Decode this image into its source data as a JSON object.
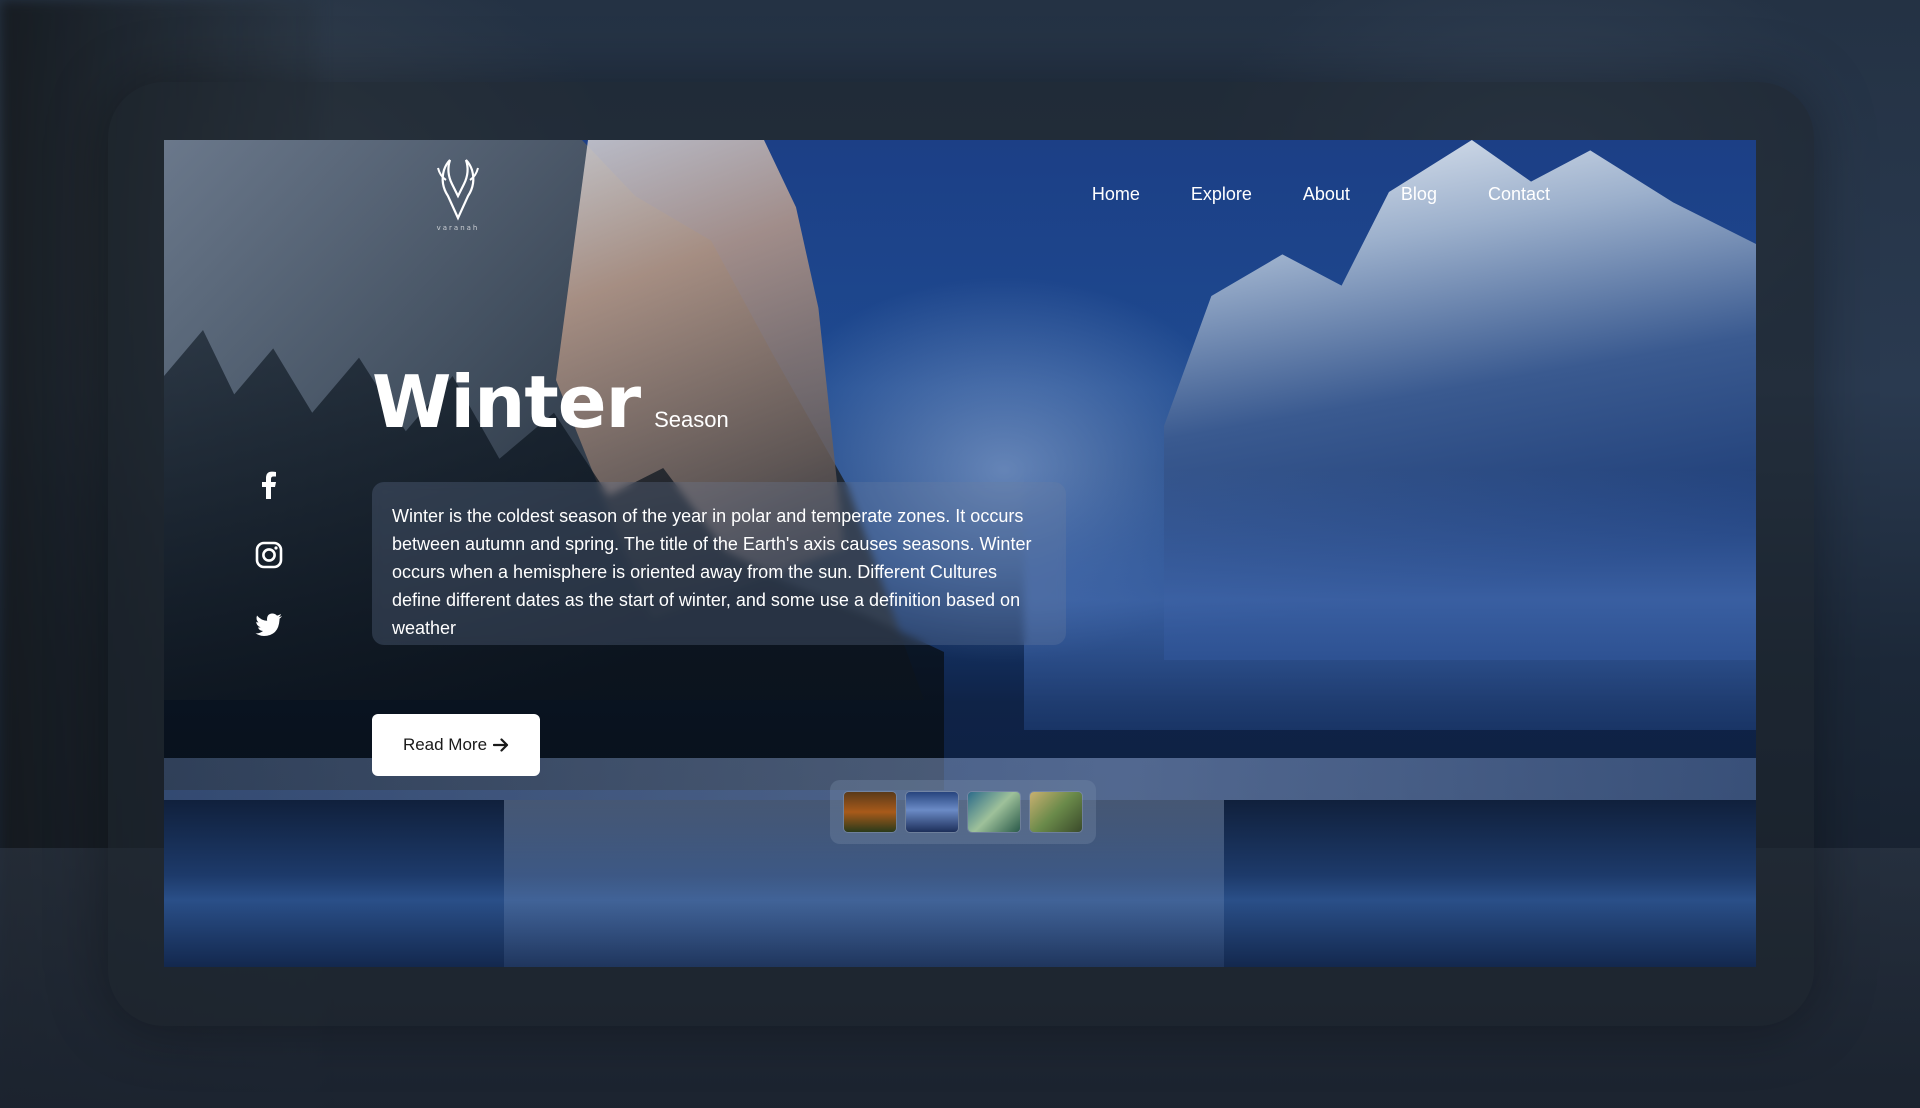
{
  "brand": {
    "name": "varanah"
  },
  "nav": {
    "items": [
      {
        "label": "Home"
      },
      {
        "label": "Explore"
      },
      {
        "label": "About"
      },
      {
        "label": "Blog"
      },
      {
        "label": "Contact"
      }
    ]
  },
  "social": {
    "icons": [
      "facebook-icon",
      "instagram-icon",
      "twitter-icon"
    ]
  },
  "hero": {
    "title": "Winter",
    "subtitle": "Season",
    "description": "Winter is the coldest season of the year in polar and temperate zones. It occurs between autumn and spring. The title of the Earth's axis causes seasons. Winter occurs when a hemisphere is oriented away from the sun. Different Cultures define different dates as the start of winter, and some use a definition based on weather",
    "button_label": "Read More",
    "button_icon": "arrow-right-icon"
  },
  "gallery": {
    "thumbnails": [
      "autumn-thumbnail",
      "winter-thumbnail",
      "spring-thumbnail",
      "summer-thumbnail"
    ]
  }
}
